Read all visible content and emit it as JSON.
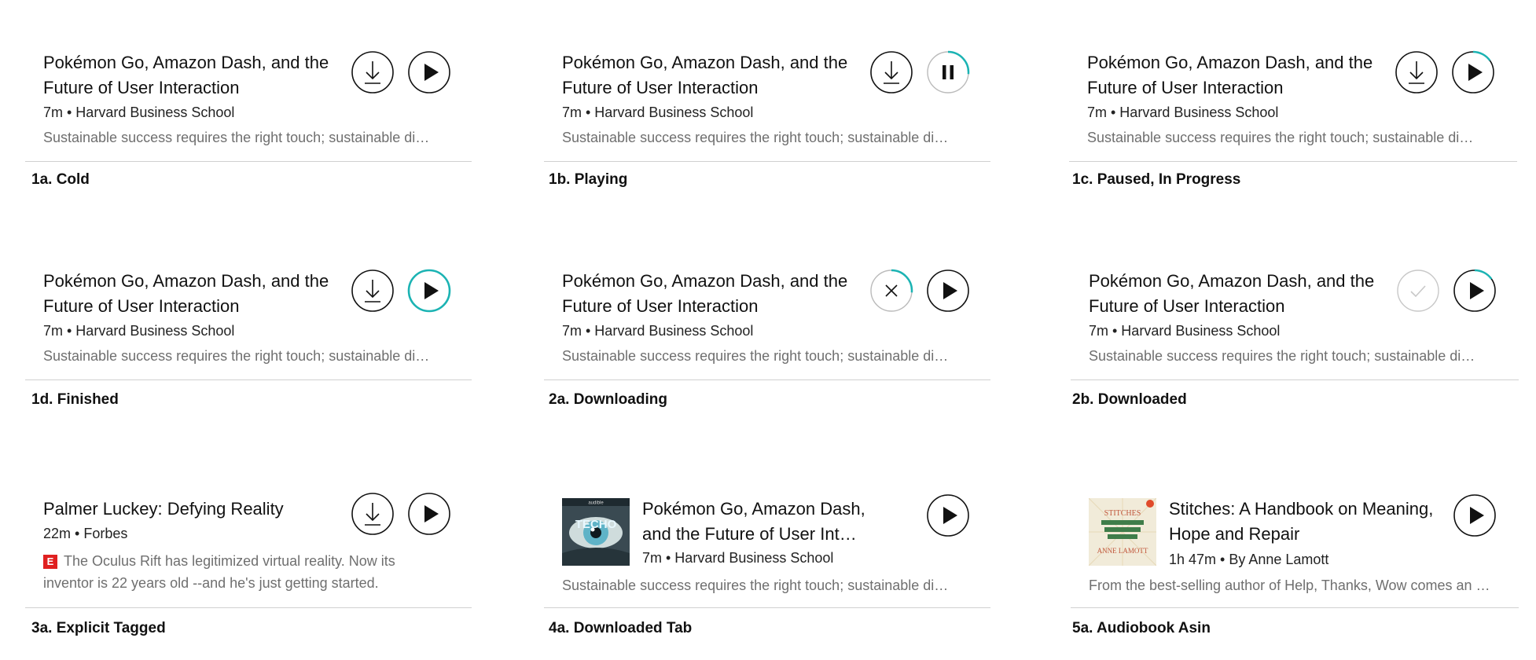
{
  "accent_color": "#1bb3b3",
  "cards": [
    {
      "caption": "1a. Cold",
      "title": "Pokémon Go, Amazon Dash, and the Future of User Interaction",
      "meta": "7m • Harvard Business School",
      "desc": "Sustainable success requires the right touch; sustainable di…",
      "download_state": "download",
      "play_state": "play-cold"
    },
    {
      "caption": "1b. Playing",
      "title": "Pokémon Go, Amazon Dash, and the Future of User Interaction",
      "meta": "7m • Harvard Business School",
      "desc": "Sustainable success requires the right touch; sustainable di…",
      "download_state": "download",
      "play_state": "pause-progress"
    },
    {
      "caption": "1c. Paused, In Progress",
      "title": "Pokémon Go, Amazon Dash, and the Future of User Interaction",
      "meta": "7m • Harvard Business School",
      "desc": "Sustainable success requires the right touch; sustainable di…",
      "download_state": "download",
      "play_state": "play-progress"
    },
    {
      "caption": "1d. Finished",
      "title": "Pokémon Go, Amazon Dash, and the Future of User Interaction",
      "meta": "7m • Harvard Business School",
      "desc": "Sustainable success requires the right touch; sustainable di…",
      "download_state": "download",
      "play_state": "play-finished"
    },
    {
      "caption": "2a. Downloading",
      "title": "Pokémon Go, Amazon Dash, and the Future of User Interaction",
      "meta": "7m • Harvard Business School",
      "desc": "Sustainable success requires the right touch; sustainable di…",
      "download_state": "downloading",
      "play_state": "play-cold"
    },
    {
      "caption": "2b. Downloaded",
      "title": "Pokémon Go, Amazon Dash, and the Future of User Interaction",
      "meta": "7m • Harvard Business School",
      "desc": "Sustainable success requires the right touch; sustainable di…",
      "download_state": "downloaded",
      "play_state": "play-progress"
    },
    {
      "caption": "3a. Explicit Tagged",
      "title": "Palmer Luckey: Defying Reality",
      "meta": "22m • Forbes",
      "explicit_badge": "E",
      "desc": "The Oculus Rift has legitimized virtual reality. Now its inventor is 22 years old --and he's just getting started.",
      "download_state": "download",
      "play_state": "play-cold"
    },
    {
      "caption": "4a. Downloaded Tab",
      "title": "Pokémon Go, Amazon Dash, and the Future of User Int…",
      "meta": "7m • Harvard Business School",
      "desc": "Sustainable success requires the right touch; sustainable di…",
      "thumb_text": "TECHO",
      "thumb_label": "audible",
      "play_state": "play-cold"
    },
    {
      "caption": "5a. Audiobook Asin",
      "title": "Stitches: A Handbook on Meaning, Hope and Repair",
      "meta": "1h 47m • By Anne Lamott",
      "desc": "From the best-selling author of Help, Thanks, Wow comes an …",
      "thumb_title": "STITCHES",
      "thumb_author": "ANNE LAMOTT",
      "play_state": "play-cold"
    }
  ]
}
